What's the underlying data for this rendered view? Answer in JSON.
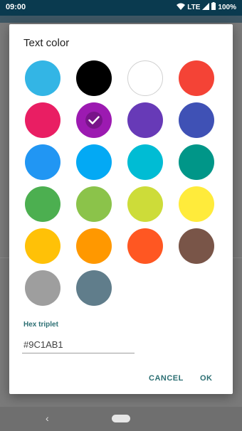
{
  "status_bar": {
    "time": "09:00",
    "network": "LTE",
    "battery": "100%"
  },
  "dialog": {
    "title": "Text color",
    "colors": [
      "#33b5e5",
      "#000000",
      "#ffffff",
      "#f44336",
      "#e91e63",
      "#9c1ab1",
      "#673ab7",
      "#3f51b5",
      "#2196f3",
      "#03a9f4",
      "#00bcd4",
      "#009688",
      "#4caf50",
      "#8bc34a",
      "#cddc39",
      "#ffeb3b",
      "#ffc107",
      "#ff9800",
      "#ff5722",
      "#795548",
      "#9e9e9e",
      "#607d8b"
    ],
    "selected_color": "#9c1ab1",
    "hex_label": "Hex triplet",
    "hex_value": "#9C1AB1",
    "cancel_label": "CANCEL",
    "ok_label": "OK"
  },
  "accent_color": "#2c6f73"
}
